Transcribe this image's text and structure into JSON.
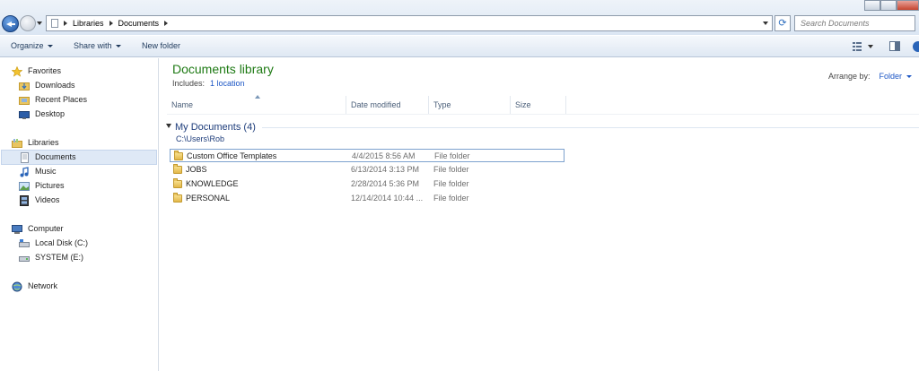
{
  "address_bar": {
    "crumbs": [
      "Libraries",
      "Documents"
    ],
    "search_placeholder": "Search Documents"
  },
  "toolbar": {
    "organize": "Organize",
    "share_with": "Share with",
    "new_folder": "New folder"
  },
  "nav": {
    "favorites": {
      "label": "Favorites",
      "items": [
        "Downloads",
        "Recent Places",
        "Desktop"
      ]
    },
    "libraries": {
      "label": "Libraries",
      "items": [
        "Documents",
        "Music",
        "Pictures",
        "Videos"
      ]
    },
    "computer": {
      "label": "Computer",
      "items": [
        "Local Disk (C:)",
        "SYSTEM (E:)"
      ]
    },
    "network": {
      "label": "Network"
    }
  },
  "main": {
    "title": "Documents library",
    "includes_label": "Includes:",
    "includes_link": "1 location",
    "arrange_label": "Arrange by:",
    "arrange_value": "Folder",
    "columns": [
      "Name",
      "Date modified",
      "Type",
      "Size"
    ],
    "group": {
      "title": "My Documents (4)",
      "path": "C:\\Users\\Rob"
    },
    "rows": [
      {
        "name": "Custom Office Templates",
        "date": "4/4/2015 8:56 AM",
        "type": "File folder"
      },
      {
        "name": "JOBS",
        "date": "6/13/2014 3:13 PM",
        "type": "File folder"
      },
      {
        "name": "KNOWLEDGE",
        "date": "2/28/2014 5:36 PM",
        "type": "File folder"
      },
      {
        "name": "PERSONAL",
        "date": "12/14/2014 10:44 ...",
        "type": "File folder"
      }
    ]
  }
}
